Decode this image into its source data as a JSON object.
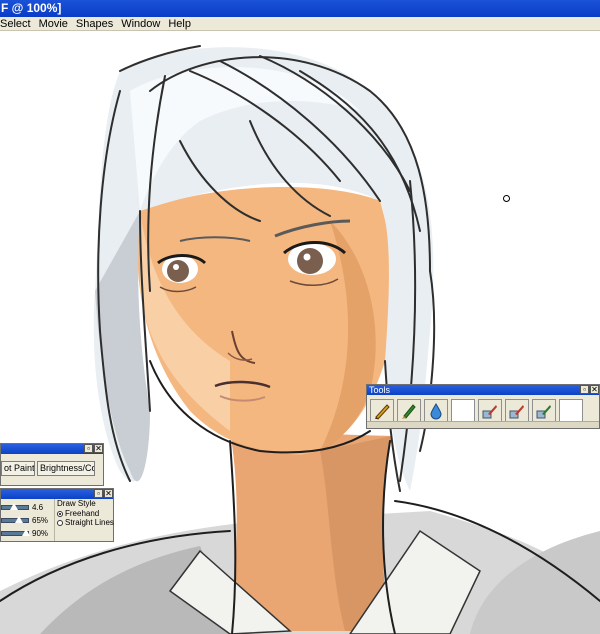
{
  "window": {
    "title": "F @ 100%]"
  },
  "menu": [
    {
      "label": "Select",
      "mnemonic": "S"
    },
    {
      "label": "Movie",
      "mnemonic": "M"
    },
    {
      "label": "Shapes",
      "mnemonic": "S"
    },
    {
      "label": "Window",
      "mnemonic": "W"
    },
    {
      "label": "Help",
      "mnemonic": "H"
    }
  ],
  "tools_palette": {
    "title": "Tools",
    "icons": [
      "pencil-icon",
      "brush-icon",
      "water-drop-icon",
      "blank-swatch",
      "bucket-brush-icon",
      "bucket-brush-icon",
      "bucket-brush-icon",
      "blank-swatch"
    ],
    "close": "✕"
  },
  "left_palette_1": {
    "buttons": [
      "ot Paint",
      "Brightness/Con..."
    ]
  },
  "left_palette_2": {
    "sliders": [
      {
        "value_label": "4.6",
        "level": 0.45
      },
      {
        "value_label": "65%",
        "level": 0.65
      },
      {
        "value_label": "90%",
        "level": 0.9
      }
    ],
    "draw_style": {
      "heading": "Draw Style",
      "options": [
        {
          "label": "Freehand",
          "selected": true
        },
        {
          "label": "Straight Lines",
          "selected": false
        }
      ]
    }
  },
  "colors": {
    "titlebar": "#0a3cc7",
    "hair": "#e6ebef",
    "skin": "#f2b07a",
    "ui": "#ece9d8"
  }
}
